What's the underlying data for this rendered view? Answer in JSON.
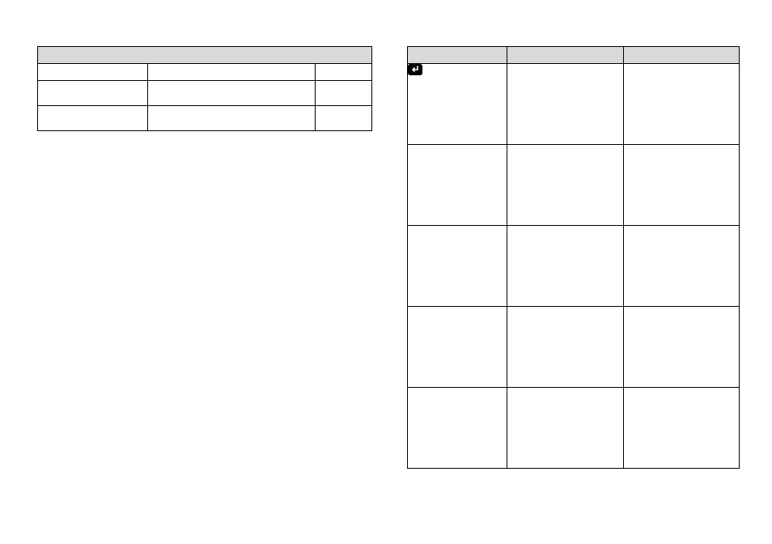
{
  "left_table": {
    "header": "",
    "rows": [
      {
        "c1": "",
        "c2": "",
        "c3": ""
      },
      {
        "c1": "",
        "c2": "",
        "c3": ""
      },
      {
        "c1": "",
        "c2": "",
        "c3": ""
      }
    ]
  },
  "right_table": {
    "header": {
      "c1": "",
      "c2": "",
      "c3": ""
    },
    "rows": [
      {
        "icon": "enter-icon",
        "c1": "",
        "c2": "",
        "c3": ""
      },
      {
        "c1": "",
        "c2": "",
        "c3": ""
      },
      {
        "c1": "",
        "c2": "",
        "c3": ""
      },
      {
        "c1": "",
        "c2": "",
        "c3": ""
      },
      {
        "c1": "",
        "c2": "",
        "c3": ""
      }
    ]
  }
}
